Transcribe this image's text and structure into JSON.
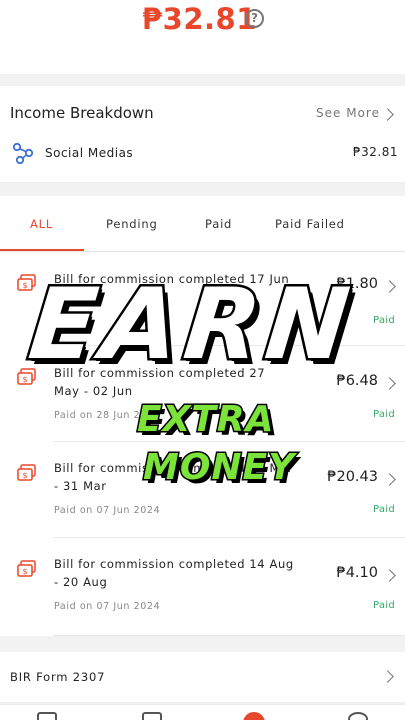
{
  "balance": {
    "amount": "₱32.81",
    "help_icon": "question-circle-icon"
  },
  "income": {
    "title": "Income Breakdown",
    "see_more": "See More",
    "items": [
      {
        "icon": "social-share-icon",
        "label": "Social Medias",
        "amount": "₱32.81"
      }
    ]
  },
  "tabs": [
    {
      "label": "ALL",
      "active": true
    },
    {
      "label": "Pending",
      "active": false
    },
    {
      "label": "Paid",
      "active": false
    },
    {
      "label": "Paid Failed",
      "active": false
    }
  ],
  "transactions": [
    {
      "title": "Bill for commission completed 17 Jun",
      "paid_on": "",
      "amount": "₱1.80",
      "status": "Paid"
    },
    {
      "title": "Bill for commission completed 27 May - 02 Jun",
      "paid_on": "Paid on 28 Jun 2024",
      "amount": "₱6.48",
      "status": "Paid"
    },
    {
      "title": "Bill for commission completed 25 Mar - 31 Mar",
      "paid_on": "Paid on 07 Jun 2024",
      "amount": "₱20.43",
      "status": "Paid"
    },
    {
      "title": "Bill for commission completed 14 Aug - 20 Aug",
      "paid_on": "Paid on 07 Jun 2024",
      "amount": "₱4.10",
      "status": "Paid"
    }
  ],
  "bir": {
    "label": "BIR Form 2307"
  },
  "overlay": {
    "line1": "EARN",
    "line2": "EXTRA",
    "line3": "MONEY"
  },
  "colors": {
    "accent": "#e8472b",
    "paid_green": "#3aa86b",
    "overlay_green": "#7be33a"
  }
}
